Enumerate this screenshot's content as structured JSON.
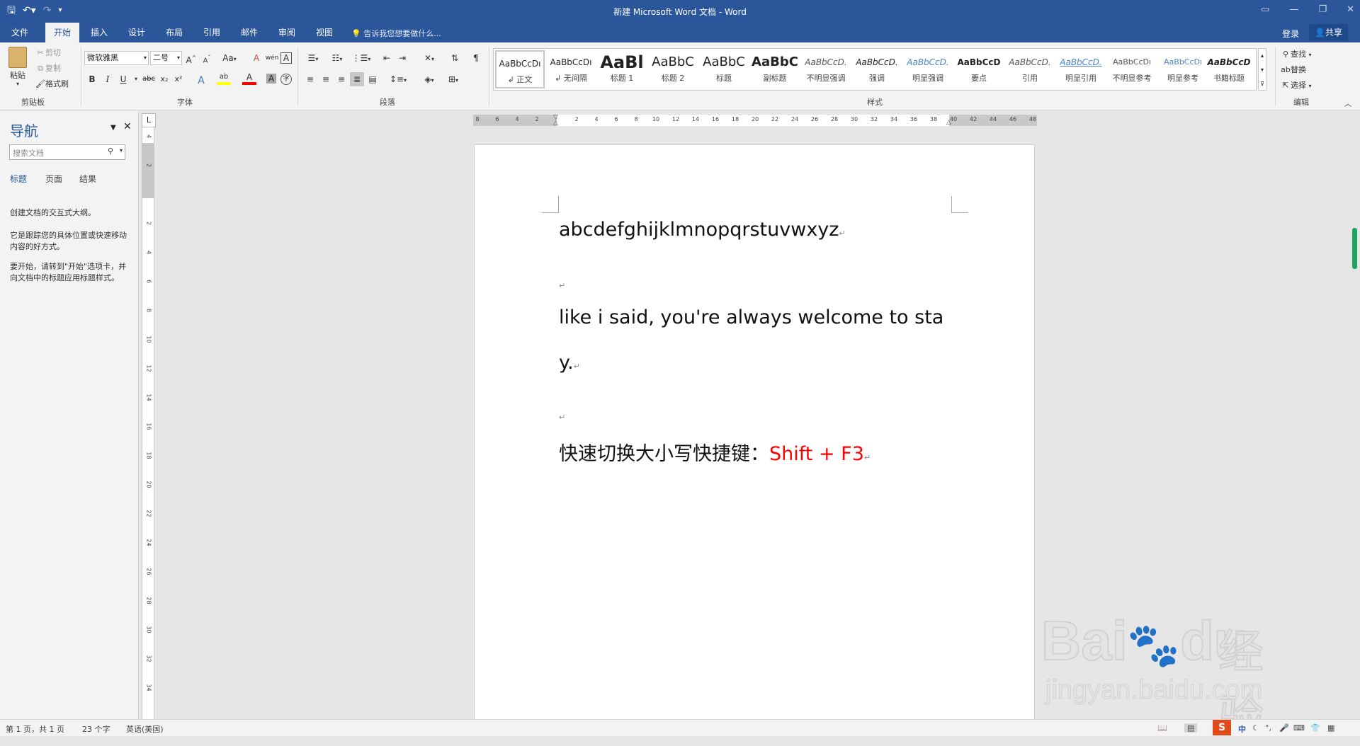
{
  "titlebar": {
    "title": "新建 Microsoft Word 文档 - Word",
    "qat": {
      "save_icon": "save-icon",
      "undo_icon": "undo-icon",
      "redo_icon": "redo-icon",
      "customize_icon": "customize-qat-icon"
    },
    "controls": {
      "ribbon_display": "▭",
      "minimize": "—",
      "restore": "❐",
      "close": "✕"
    }
  },
  "tabs": [
    {
      "label": "文件"
    },
    {
      "label": "开始"
    },
    {
      "label": "插入"
    },
    {
      "label": "设计"
    },
    {
      "label": "布局"
    },
    {
      "label": "引用"
    },
    {
      "label": "邮件"
    },
    {
      "label": "审阅"
    },
    {
      "label": "视图"
    }
  ],
  "tell_me": "告诉我您想要做什么...",
  "signin": "登录",
  "share": "共享",
  "ribbon": {
    "clipboard": {
      "paste": "粘贴",
      "cut": "剪切",
      "copy": "复制",
      "format_painter": "格式刷",
      "group_label": "剪贴板"
    },
    "font": {
      "font_name": "微软雅黑",
      "font_size": "二号",
      "group_label": "字体",
      "buttons": {
        "bold": "B",
        "italic": "I",
        "underline": "U",
        "strike": "abc",
        "subscript": "x₂",
        "superscript": "x²",
        "grow": "A",
        "shrink": "A",
        "case": "Aa",
        "clear": "A",
        "pinyin": "wén",
        "border": "A",
        "effects": "A",
        "highlight": "ab",
        "color": "A",
        "shading": "A",
        "enclose": "字"
      }
    },
    "paragraph": {
      "group_label": "段落"
    },
    "styles": {
      "group_label": "样式",
      "items": [
        {
          "preview": "AaBbCcDı",
          "name": "↲ 正文"
        },
        {
          "preview": "AaBbCcDı",
          "name": "↲ 无间隔"
        },
        {
          "preview": "AaBl",
          "name": "标题 1"
        },
        {
          "preview": "AaBbC",
          "name": "标题 2"
        },
        {
          "preview": "AaBbC",
          "name": "标题"
        },
        {
          "preview": "AaBbC",
          "name": "副标题"
        },
        {
          "preview": "AaBbCcD.",
          "name": "不明显强调"
        },
        {
          "preview": "AaBbCcD.",
          "name": "强调"
        },
        {
          "preview": "AaBbCcD.",
          "name": "明显强调"
        },
        {
          "preview": "AaBbCcD",
          "name": "要点"
        },
        {
          "preview": "AaBbCcD.",
          "name": "引用"
        },
        {
          "preview": "AaBbCcD.",
          "name": "明显引用"
        },
        {
          "preview": "AaBbCcDı",
          "name": "不明显参考"
        },
        {
          "preview": "AaBbCcDı",
          "name": "明显参考"
        },
        {
          "preview": "AaBbCcD",
          "name": "书籍标题"
        }
      ]
    },
    "editing": {
      "find": "查找",
      "replace": "替换",
      "select": "选择",
      "group_label": "编辑"
    }
  },
  "nav": {
    "title": "导航",
    "search_placeholder": "搜索文档",
    "tabs": [
      {
        "label": "标题"
      },
      {
        "label": "页面"
      },
      {
        "label": "结果"
      }
    ],
    "p1": "创建文档的交互式大纲。",
    "p2": "它是跟踪您的具体位置或快速移动内容的好方式。",
    "p3": "要开始，请转到\"开始\"选项卡，并向文档中的标题应用标题样式。"
  },
  "ruler": {
    "h_ticks": [
      "8",
      "6",
      "4",
      "2",
      "",
      "2",
      "4",
      "6",
      "8",
      "10",
      "12",
      "14",
      "16",
      "18",
      "20",
      "22",
      "24",
      "26",
      "28",
      "30",
      "32",
      "34",
      "36",
      "38",
      "40",
      "42",
      "44",
      "46",
      "48"
    ],
    "v_ticks": [
      "4",
      "2",
      "",
      "2",
      "4",
      "6",
      "8",
      "10",
      "12",
      "14",
      "16",
      "18",
      "20",
      "22",
      "24",
      "26",
      "28",
      "30",
      "32",
      "34"
    ],
    "tab_selector": "L"
  },
  "document": {
    "line1": "abcdefghijklmnopqrstuvwxyz",
    "line2a": "like i said, you're always welcome to sta",
    "line2b": "y.",
    "line3_prefix": "快速切换大小写快捷键：",
    "line3_shortcut": "Shift + F3",
    "shortcut_color": "#ff0000",
    "para_mark": "↵"
  },
  "status": {
    "page": "第 1 页，共 1 页",
    "words": "23 个字",
    "lang": "英语(美国)"
  },
  "watermark": {
    "brand": "Bai",
    "brand2": "du",
    "cn": "经验",
    "url": "jingyan.baidu.com"
  },
  "colors": {
    "accent": "#2b579a",
    "scroll_thumb": "#1ea362"
  }
}
